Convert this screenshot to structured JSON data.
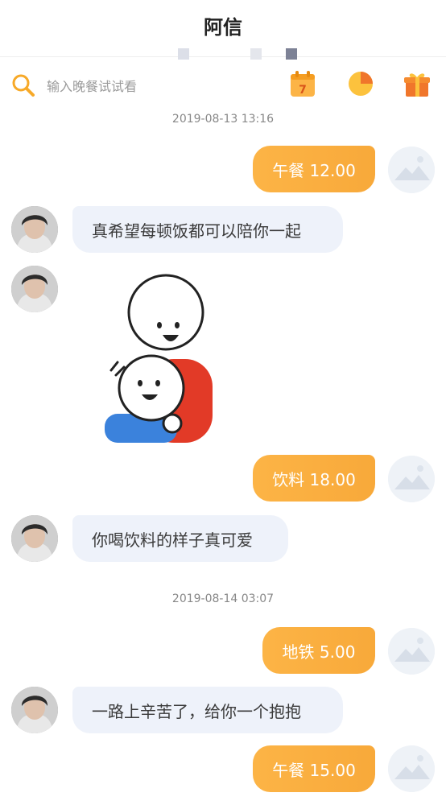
{
  "header": {
    "title": "阿信"
  },
  "search": {
    "placeholder": "输入晚餐试试看"
  },
  "toolbar": {
    "icons": [
      "search-icon",
      "calendar-icon",
      "pie-chart-icon",
      "gift-icon"
    ],
    "calendar_day": "7"
  },
  "colors": {
    "accent": "#fcb446",
    "incoming_bubble": "#eef2fa",
    "timestamp": "#888888"
  },
  "messages": [
    {
      "type": "time",
      "text": "2019-08-13 13:16"
    },
    {
      "type": "out",
      "text": "午餐 12.00"
    },
    {
      "type": "in",
      "text": "真希望每顿饭都可以陪你一起"
    },
    {
      "type": "sticker",
      "icon": "hug-sticker"
    },
    {
      "type": "out",
      "text": "饮料 18.00"
    },
    {
      "type": "in",
      "text": "你喝饮料的样子真可爱"
    },
    {
      "type": "time",
      "text": "2019-08-14 03:07"
    },
    {
      "type": "out",
      "text": "地铁 5.00"
    },
    {
      "type": "in",
      "text": "一路上辛苦了，给你一个抱抱"
    },
    {
      "type": "out",
      "text": "午餐 15.00"
    }
  ]
}
